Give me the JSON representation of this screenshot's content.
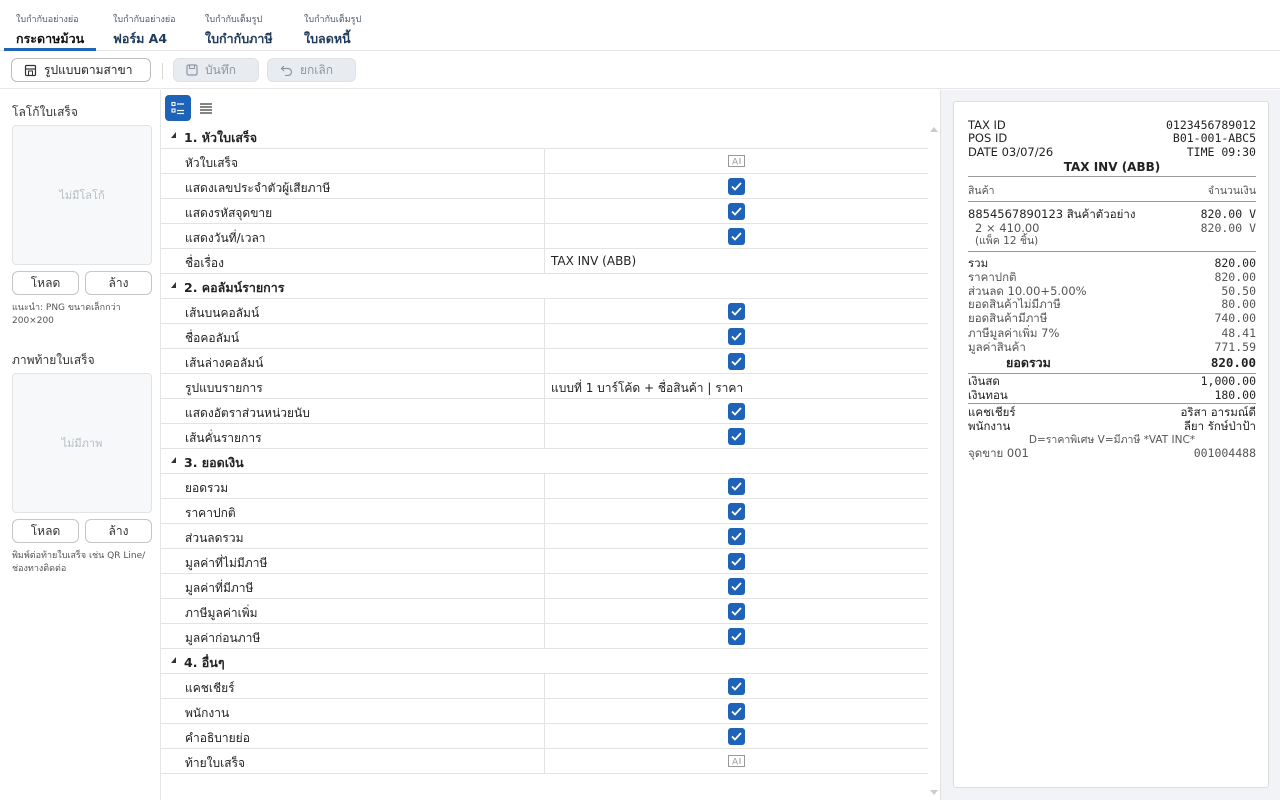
{
  "tabs": [
    {
      "sub": "ใบกำกับอย่างย่อ",
      "main": "กระดาษม้วน"
    },
    {
      "sub": "ใบกำกับอย่างย่อ",
      "main": "ฟอร์ม A4"
    },
    {
      "sub": "ใบกำกับเต็มรูป",
      "main": "ใบกำกับภาษี"
    },
    {
      "sub": "ใบกำกับเต็มรูป",
      "main": "ใบลดหนี้"
    }
  ],
  "toolbar": {
    "branch_label": "รูปแบบตามสาขา",
    "save_label": "บันทึก",
    "cancel_label": "ยกเลิก"
  },
  "left": {
    "logo_title": "โลโก้ใบเสร็จ",
    "logo_placeholder": "ไม่มีโลโก้",
    "load_label": "โหลด",
    "clear_label": "ล้าง",
    "logo_hint": "แนะนำ: PNG ขนาดเล็กกว่า 200×200",
    "footer_title": "ภาพท้ายใบเสร็จ",
    "footer_placeholder": "ไม่มีภาพ",
    "footer_hint": "พิมพ์ต่อท้ายใบเสร็จ เช่น QR Line/ช่องทางติดต่อ"
  },
  "grid": {
    "g1": "1. หัวใบเสร็จ",
    "r1": "หัวใบเสร็จ",
    "r2": "แสดงเลขประจำตัวผู้เสียภาษี",
    "r3": "แสดงรหัสจุดขาย",
    "r4": "แสดงวันที่/เวลา",
    "r5": "ชื่อเรื่อง",
    "r5v": "TAX INV (ABB)",
    "g2": "2. คอลัมน์รายการ",
    "r6": "เส้นบนคอลัมน์",
    "r7": "ชื่อคอลัมน์",
    "r8": "เส้นล่างคอลัมน์",
    "r9": "รูปแบบรายการ",
    "r9v": "แบบที่ 1  บาร์โค้ด + ชื่อสินค้า | ราคา",
    "r10": "แสดงอัตราส่วนหน่วยนับ",
    "r11": "เส้นคั่นรายการ",
    "g3": "3. ยอดเงิน",
    "r12": "ยอดรวม",
    "r13": "ราคาปกติ",
    "r14": "ส่วนลดรวม",
    "r15": "มูลค่าที่ไม่มีภาษี",
    "r16": "มูลค่าที่มีภาษี",
    "r17": "ภาษีมูลค่าเพิ่ม",
    "r18": "มูลค่าก่อนภาษี",
    "g4": "4. อื่นๆ",
    "r19": "แคชเชียร์",
    "r20": "พนักงาน",
    "r21": "คำอธิบายย่อ",
    "r22": "ท้ายใบเสร็จ"
  },
  "receipt": {
    "taxid_k": "TAX ID",
    "taxid_v": "0123456789012",
    "pos_k": "POS ID",
    "pos_v": "B01-001-ABC5",
    "date_k": "DATE 03/07/26",
    "time_v": "TIME 09:30",
    "title": "TAX INV (ABB)",
    "col_item": "สินค้า",
    "col_amount": "จำนวนเงิน",
    "item_name": "8854567890123 สินค้าตัวอย่าง",
    "item_amount": "820.00 V",
    "item_qty": "2 × 410.00",
    "item_qty_amount": "820.00 V",
    "item_pack": "(แพ็ค 12 ชิ้น)",
    "sum_k": "รวม",
    "sum_v": "820.00",
    "regular_k": "ราคาปกติ",
    "regular_v": "820.00",
    "disc_k": "ส่วนลด 10.00+5.00%",
    "disc_v": "50.50",
    "novat_k": "ยอดสินค้าไม่มีภาษี",
    "novat_v": "80.00",
    "vat_k": "ยอดสินค้ามีภาษี",
    "vat_v": "740.00",
    "vat7_k": "ภาษีมูลค่าเพิ่ม 7%",
    "vat7_v": "48.41",
    "net_k": "มูลค่าสินค้า",
    "net_v": "771.59",
    "total_k": "ยอดรวม",
    "total_v": "820.00",
    "cash_k": "เงินสด",
    "cash_v": "1,000.00",
    "change_k": "เงินทอน",
    "change_v": "180.00",
    "cashier_k": "แคชเชียร์",
    "cashier_v": "อริสา  อารมณ์ดี",
    "staff_k": "พนักงาน",
    "staff_v": "ลียา  รักษ์ป่าป้า",
    "legend": "D=ราคาพิเศษ  V=มีภาษี  *VAT INC*",
    "pos_point_k": "จุดขาย 001",
    "pos_point_v": "001004488"
  },
  "colors": {
    "accent": "#1e63b8"
  }
}
